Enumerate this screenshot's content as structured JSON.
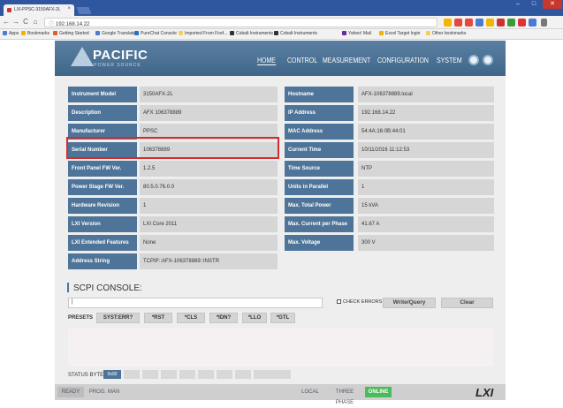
{
  "browser": {
    "tab_title": "LXI-PPSC-3150AFX-2L",
    "tab_close": "×",
    "url": "192.168.14.22",
    "nav_back": "←",
    "nav_forward": "→",
    "nav_reload": "C",
    "nav_home": "⌂",
    "info_icon": "ⓘ",
    "window_minimize": "–",
    "window_maximize": "□",
    "window_close": "✕",
    "bookmarks": [
      {
        "label": "Apps",
        "color": "#4a7bd0"
      },
      {
        "label": "Bookmarks",
        "color": "#f0b400"
      },
      {
        "label": "Getting Started",
        "color": "#e0602a"
      },
      {
        "label": "Google Translate",
        "color": "#4a7bd0"
      },
      {
        "label": "PureChat Console",
        "color": "#2a70c0"
      },
      {
        "label": "Imported From Firef...",
        "color": "#f0d060"
      },
      {
        "label": "Cobalt Instruments",
        "color": "#333"
      },
      {
        "label": "Cobalt Instruments",
        "color": "#333"
      },
      {
        "label": "Yahoo! Mail",
        "color": "#6a2aa0"
      },
      {
        "label": "Excel Target login",
        "color": "#f0b400"
      },
      {
        "label": "Other bookmarks",
        "color": "#f0d060"
      }
    ]
  },
  "header": {
    "logo": "PACIFIC",
    "logo_sub": "POWER SOURCE",
    "nav": [
      "HOME",
      "CONTROL",
      "MEASUREMENT",
      "CONFIGURATION",
      "SYSTEM"
    ],
    "active_nav": "HOME"
  },
  "info_left": [
    {
      "label": "Instrument Model",
      "value": "3150AFX-2L"
    },
    {
      "label": "Description",
      "value": "AFX 106378889"
    },
    {
      "label": "Manufacturer",
      "value": "PPSC"
    },
    {
      "label": "Serial Number",
      "value": "106378889"
    },
    {
      "label": "Front Panel FW Ver.",
      "value": "1.2.5"
    },
    {
      "label": "Power Stage FW Ver.",
      "value": "80.5.0.76.0.0"
    },
    {
      "label": "Hardware Revision",
      "value": "1"
    },
    {
      "label": "LXI Version",
      "value": "LXI Core 2011"
    },
    {
      "label": "LXI Extended Features",
      "value": "None"
    },
    {
      "label": "Address String",
      "value": "TCPIP::AFX-106378889::INSTR"
    }
  ],
  "info_right": [
    {
      "label": "Hostname",
      "value": "AFX-106378889.local"
    },
    {
      "label": "IP Address",
      "value": "192.168.14.22"
    },
    {
      "label": "MAC Address",
      "value": "54:4A:16:0B:44:01"
    },
    {
      "label": "Current Time",
      "value": "10/11/2016 11:12:53"
    },
    {
      "label": "Time Source",
      "value": "NTP"
    },
    {
      "label": "Units in Parallel",
      "value": "1"
    },
    {
      "label": "Max. Total Power",
      "value": "15 kVA"
    },
    {
      "label": "Max. Current per Phase",
      "value": "41.67 A"
    },
    {
      "label": "Max. Voltage",
      "value": "300 V"
    }
  ],
  "scpi": {
    "title": "SCPI CONSOLE:",
    "input_value": "|",
    "check_errors": "CHECK ERRORS",
    "write_query": "Write/Query",
    "clear": "Clear",
    "presets_label": "PRESETS",
    "presets": [
      "SYST:ERR?",
      "*RST",
      "*CLS",
      "*IDN?",
      "*LLO",
      "*GTL"
    ]
  },
  "status_byte": {
    "label": "STATUS BYTE",
    "value": "0x00"
  },
  "footer": {
    "ready": "READY",
    "prog_man": "PROG. MAN",
    "local": "LOCAL",
    "phase": "THREE PHASE",
    "online": "ONLINE",
    "lxi": "LXI"
  },
  "colors": {
    "header": "#4e7599",
    "highlight": "#d42b2b",
    "online": "#4cba5a"
  }
}
